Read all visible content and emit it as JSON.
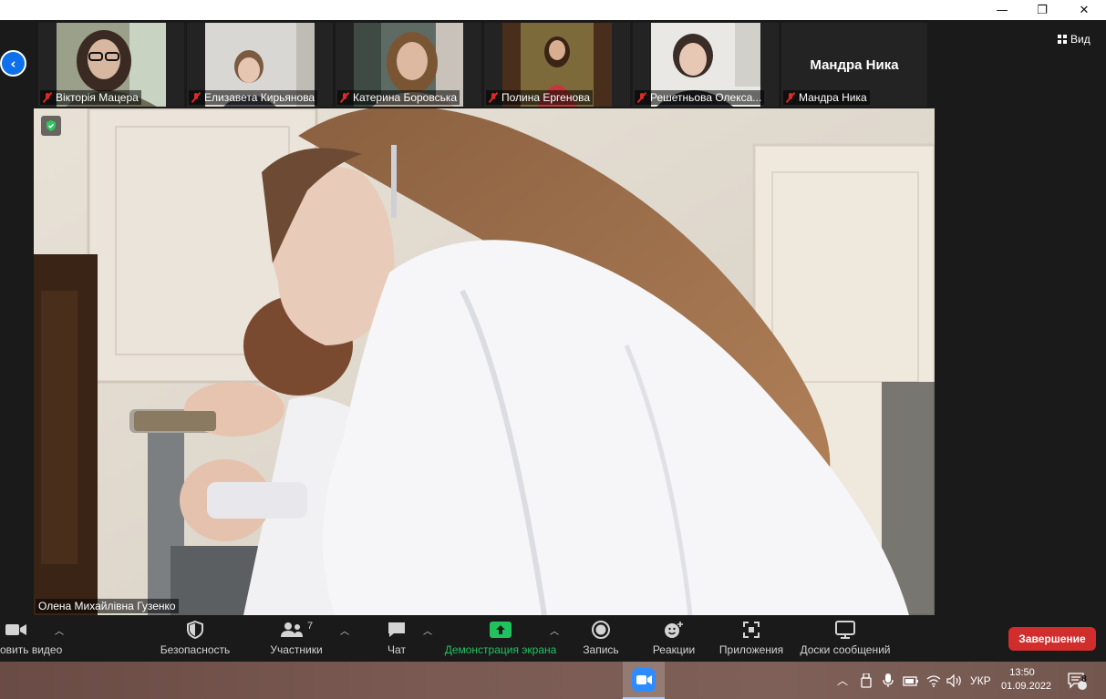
{
  "window": {
    "controls": {
      "minimize": "—",
      "maximize": "❐",
      "close": "✕"
    }
  },
  "view_button": {
    "label": "Вид"
  },
  "participants_strip": [
    {
      "name": "Вікторія Мацера",
      "muted": true
    },
    {
      "name": "Елизавета Кирьянова",
      "muted": true
    },
    {
      "name": "Катерина Боровська",
      "muted": true
    },
    {
      "name": "Полина Ергенова",
      "muted": true
    },
    {
      "name": "Решетньова Олекса...",
      "muted": true
    },
    {
      "name": "Мандра Ника",
      "muted": true,
      "video_off": true,
      "display_name": "Мандра Ника"
    }
  ],
  "main_video": {
    "speaker_name": "Олена Михайлівна Гузенко"
  },
  "toolbar": {
    "video_label": "овить видео",
    "security_label": "Безопасность",
    "participants_label": "Участники",
    "participants_count": "7",
    "chat_label": "Чат",
    "share_label": "Демонстрация экрана",
    "record_label": "Запись",
    "reactions_label": "Реакции",
    "apps_label": "Приложения",
    "whiteboards_label": "Доски сообщений",
    "end_label": "Завершение",
    "accent_green": "#21c25e",
    "end_red": "#d22d2d"
  },
  "taskbar": {
    "language": "УКР",
    "time": "13:50",
    "date": "01.09.2022",
    "notifications": "8"
  }
}
